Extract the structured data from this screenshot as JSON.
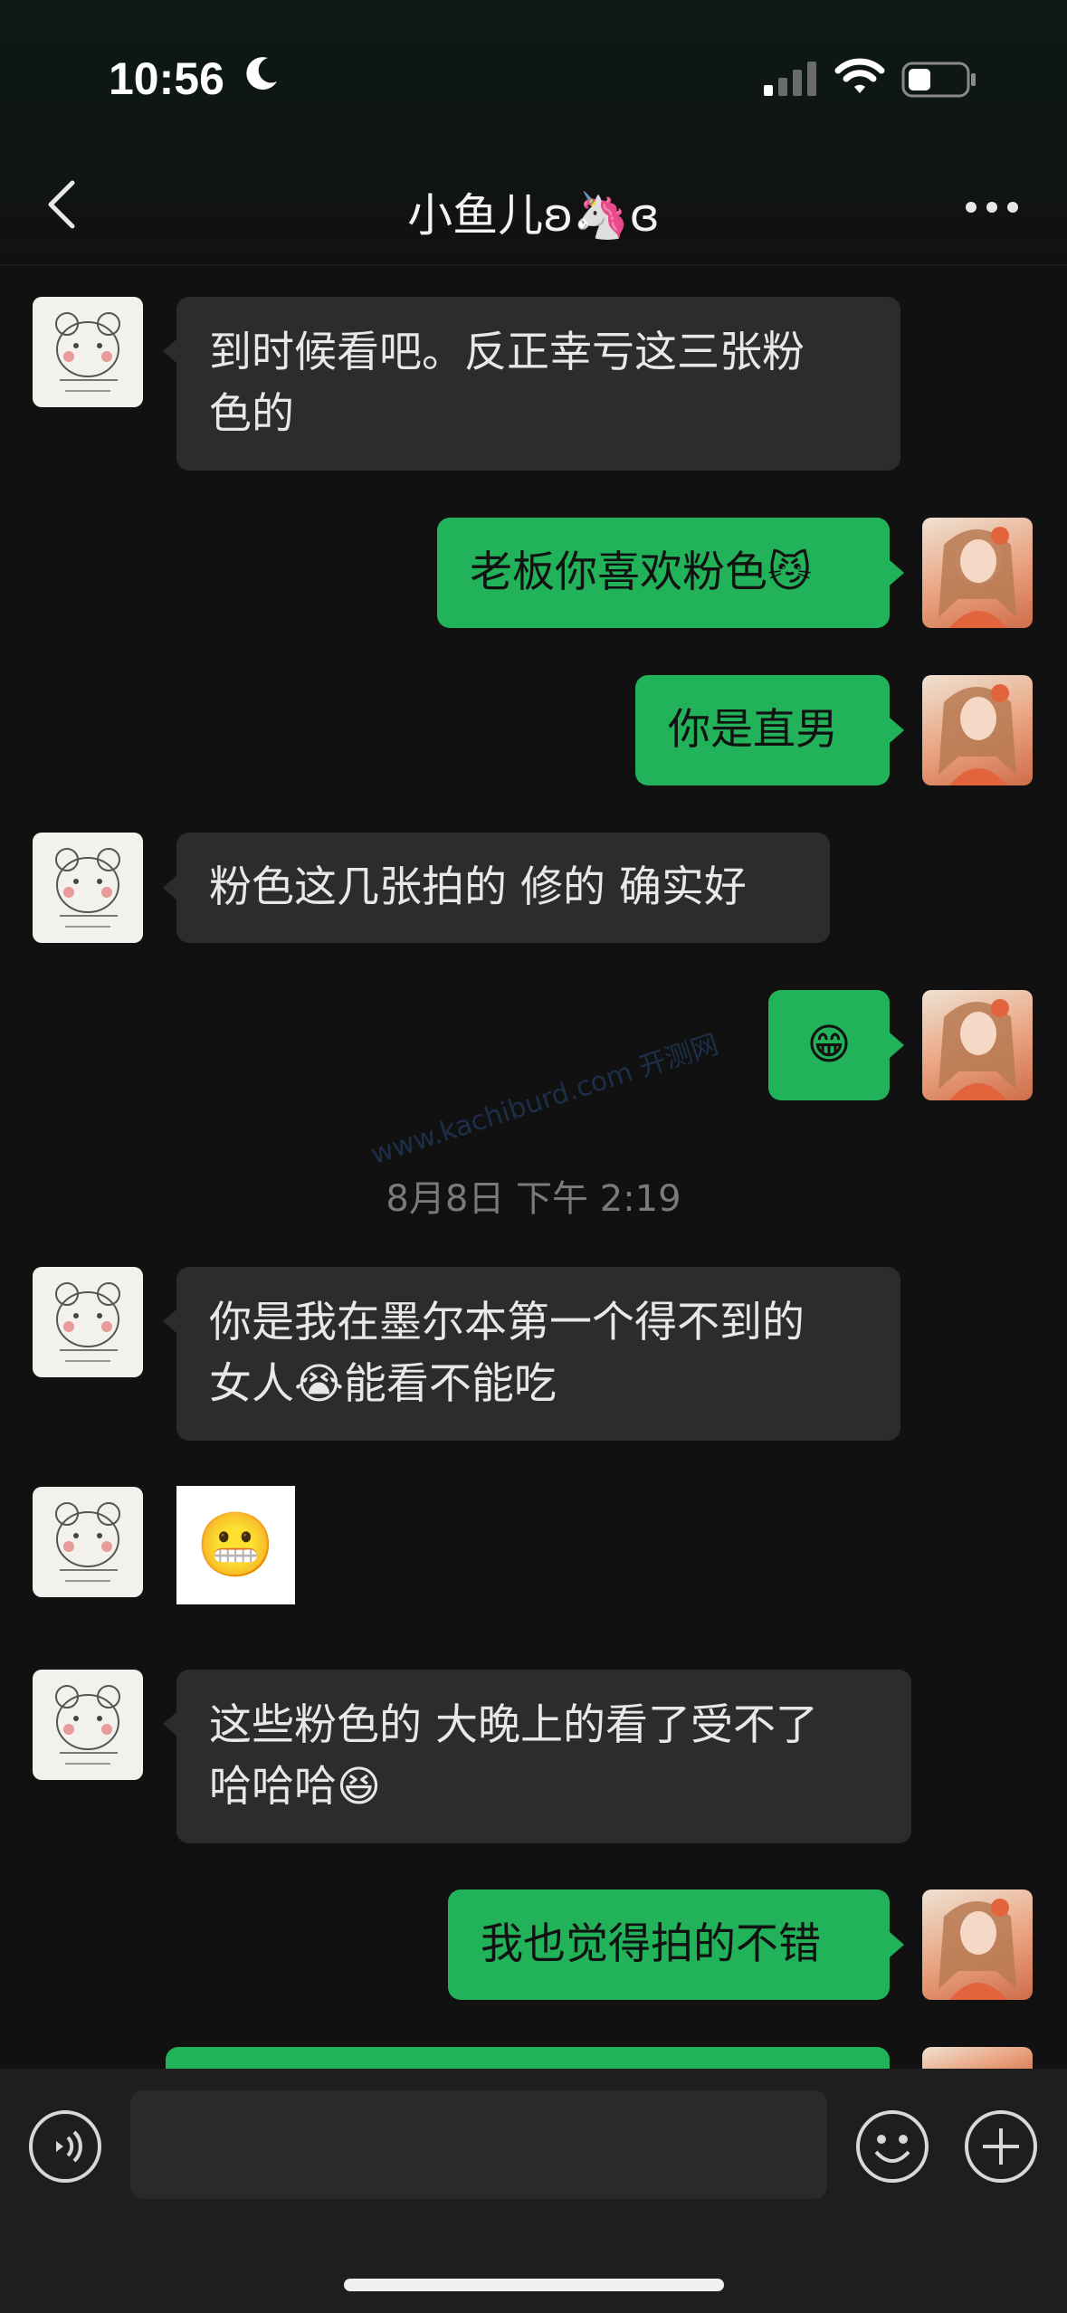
{
  "status_bar": {
    "time": "10:56"
  },
  "header": {
    "title": "小鱼儿ʚ🦄ɞ"
  },
  "messages": [
    {
      "side": "in",
      "text1": "到时候看吧。反正幸亏这三张粉",
      "text2": "色的"
    },
    {
      "side": "out",
      "text": "老板你喜欢粉色😼"
    },
    {
      "side": "out",
      "text": "你是直男"
    },
    {
      "side": "in",
      "text": "粉色这几张拍的 修的 确实好"
    },
    {
      "side": "out",
      "text": "😁"
    },
    {
      "side": "in",
      "text1": "你是我在墨尔本第一个得不到的",
      "text2": "女人😭能看不能吃"
    },
    {
      "side": "in",
      "sticker": "😬"
    },
    {
      "side": "in",
      "text1": "这些粉色的 大晚上的看了受不了",
      "text2": " 哈哈哈😆"
    },
    {
      "side": "out",
      "text": "我也觉得拍的不错"
    }
  ],
  "timestamp": "8月8日 下午 2:19",
  "watermark": "www.kachiburd.com 开测网",
  "input": {
    "value": "",
    "placeholder": ""
  },
  "icons": {
    "moon": "moon-icon",
    "signal": "cellular-signal-icon",
    "wifi": "wifi-icon",
    "battery": "battery-icon",
    "back": "chevron-left-icon",
    "more": "more-icon",
    "voice": "voice-icon",
    "emoji": "emoji-icon",
    "plus": "plus-icon"
  }
}
